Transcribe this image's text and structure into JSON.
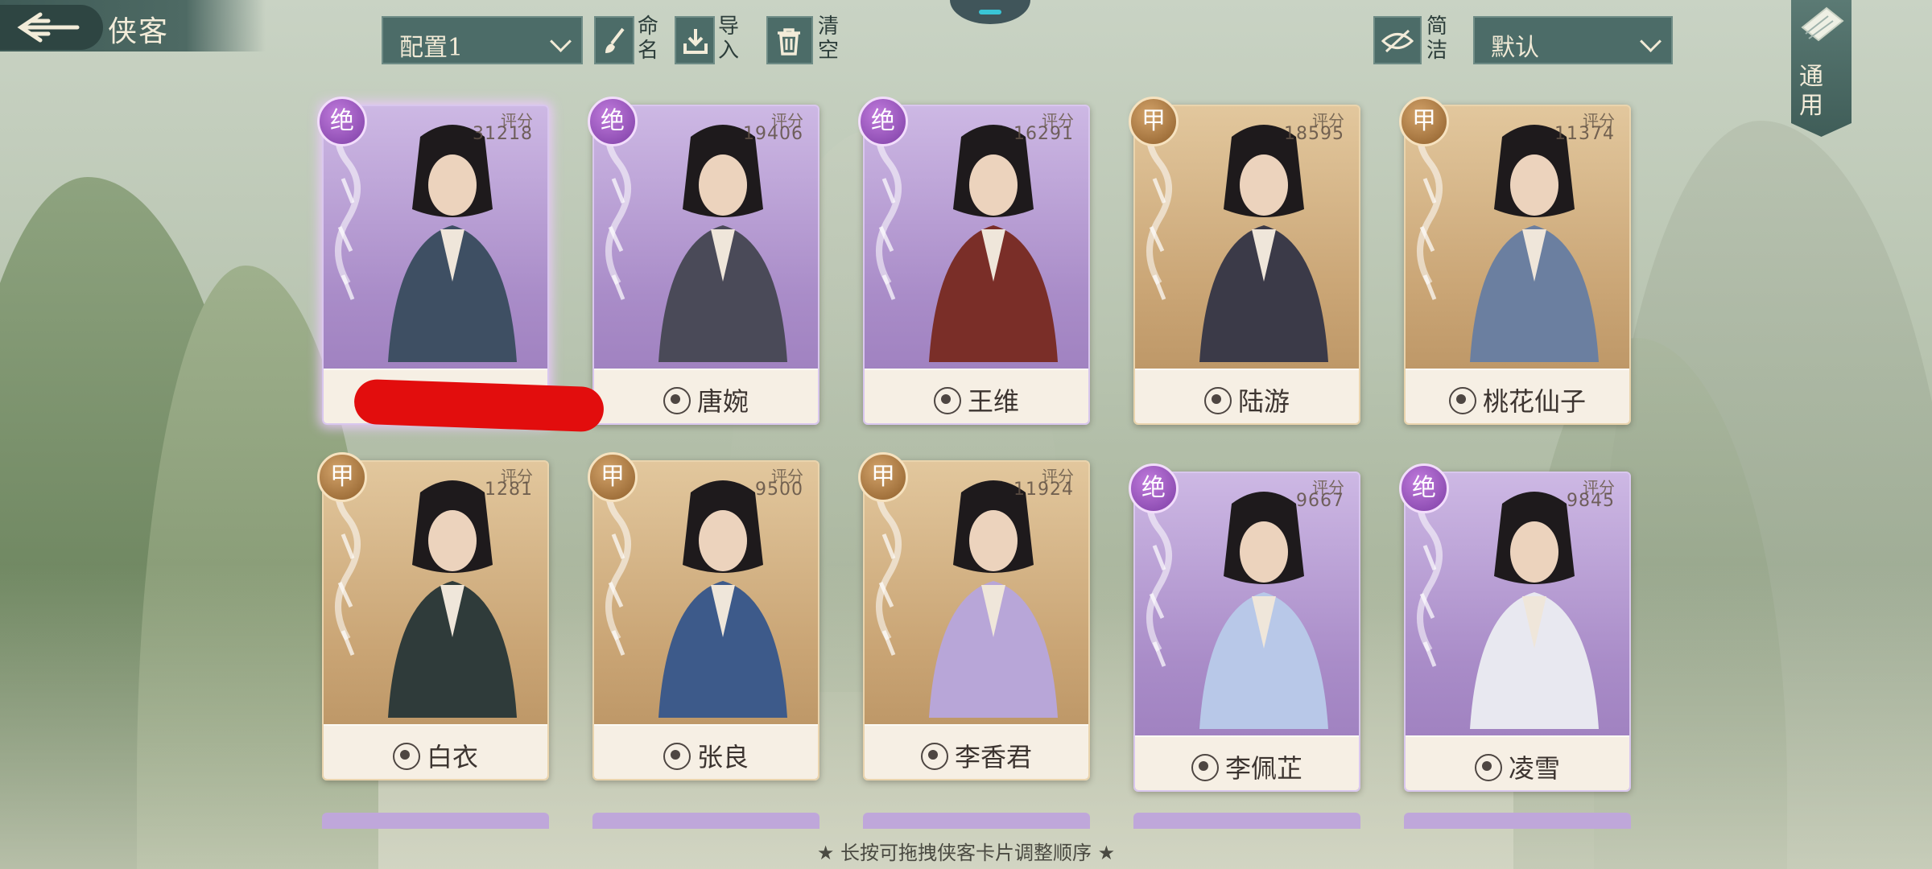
{
  "header": {
    "title": "侠客"
  },
  "toolbar": {
    "preset_value": "配置1",
    "rename_label": "命名",
    "import_label": "导入",
    "clear_label": "清空",
    "simple_label": "简洁",
    "sort_value": "默认",
    "general_label": "通用"
  },
  "cards": [
    {
      "rank": "绝",
      "score_label": "评分",
      "score": "31218",
      "name": "",
      "tier": "purple"
    },
    {
      "rank": "绝",
      "score_label": "评分",
      "score": "19406",
      "name": "唐婉",
      "tier": "purple"
    },
    {
      "rank": "绝",
      "score_label": "评分",
      "score": "16291",
      "name": "王维",
      "tier": "purple"
    },
    {
      "rank": "甲",
      "score_label": "评分",
      "score": "18595",
      "name": "陆游",
      "tier": "gold"
    },
    {
      "rank": "甲",
      "score_label": "评分",
      "score": "11374",
      "name": "桃花仙子",
      "tier": "gold"
    },
    {
      "rank": "甲",
      "score_label": "评分",
      "score": "1281",
      "name": "白衣",
      "tier": "gold"
    },
    {
      "rank": "甲",
      "score_label": "评分",
      "score": "9500",
      "name": "张良",
      "tier": "gold"
    },
    {
      "rank": "甲",
      "score_label": "评分",
      "score": "11924",
      "name": "李香君",
      "tier": "gold"
    },
    {
      "rank": "绝",
      "score_label": "评分",
      "score": "9667",
      "name": "李佩芷",
      "tier": "purple"
    },
    {
      "rank": "绝",
      "score_label": "评分",
      "score": "9845",
      "name": "凌雪",
      "tier": "purple"
    }
  ],
  "footer": {
    "hint": "★ 长按可拖拽侠客卡片调整顺序 ★"
  },
  "colors": {
    "accent": "#4c6c68",
    "purple_tier": "#a98cc8",
    "gold_tier": "#c9a474",
    "redaction": "#e20d0d"
  }
}
